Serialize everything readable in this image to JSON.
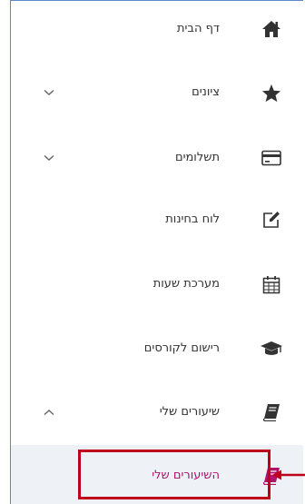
{
  "menu": {
    "items": [
      {
        "label": "דף הבית",
        "icon": "home-icon",
        "expandable": false
      },
      {
        "label": "ציונים",
        "icon": "star-icon",
        "expandable": true,
        "chevron": "chevron-down-icon"
      },
      {
        "label": "תשלומים",
        "icon": "credit-card-icon",
        "expandable": true,
        "chevron": "chevron-down-icon"
      },
      {
        "label": "לוח בחינות",
        "icon": "edit-icon",
        "expandable": false
      },
      {
        "label": "מערכת שעות",
        "icon": "calendar-icon",
        "expandable": false
      },
      {
        "label": "רישום לקורסים",
        "icon": "graduation-cap-icon",
        "expandable": false
      },
      {
        "label": "שיעורים שלי",
        "icon": "book-icon",
        "expandable": true,
        "chevron": "chevron-up-icon"
      }
    ],
    "submenu": {
      "label": "השיעורים שלי",
      "icon": "book-icon",
      "highlighted": true
    }
  },
  "colors": {
    "icon": "#333333",
    "text": "#333333",
    "chevron": "#666666",
    "active_text": "#b0126c",
    "active_icon": "#b0126c",
    "submenu_bg": "#eef1f5",
    "highlight_border": "#c0001a",
    "frame_border": "#5b89c9"
  }
}
